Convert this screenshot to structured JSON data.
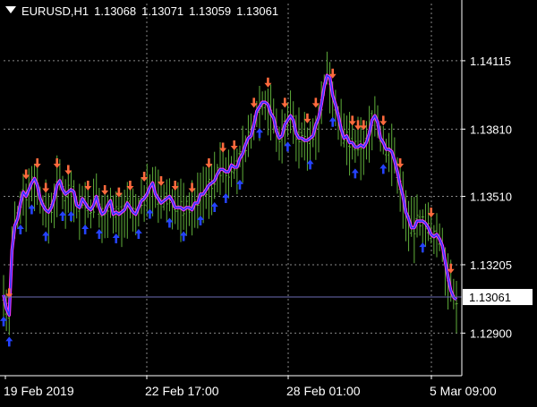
{
  "header": {
    "symbol": "EURUSD,H1",
    "open": "1.13068",
    "high": "1.13071",
    "low": "1.13059",
    "close": "1.13061"
  },
  "current_price_label": "1.13061",
  "colors": {
    "background": "#000000",
    "axis": "#ffffff",
    "grid": "#888888",
    "bars": "#5fae3a",
    "ma_outer": "#ff33ff",
    "ma_inner": "#1f3cff",
    "arrow_up": "#2442ff",
    "arrow_down": "#ff6a3d",
    "price_line": "#6b6bb5"
  },
  "chart_data": {
    "type": "ohlc",
    "title": "EURUSD,H1",
    "y_ticks": [
      "1.14115",
      "1.13810",
      "1.13510",
      "1.13205",
      "1.12900"
    ],
    "x_ticks": [
      "19 Feb 2019",
      "22 Feb 17:00",
      "28 Feb 01:00",
      "5 Mar 09:00"
    ],
    "ylim": [
      1.1271,
      1.1437
    ],
    "current_price": 1.13061,
    "grid": true,
    "series": [
      {
        "kind": "moving_average",
        "values": [
          1.1307,
          1.1301,
          1.1298,
          1.1327,
          1.1338,
          1.1341,
          1.1348,
          1.1353,
          1.1351,
          1.1354,
          1.1357,
          1.1359,
          1.1356,
          1.135,
          1.1347,
          1.1345,
          1.1344,
          1.1346,
          1.135,
          1.1356,
          1.1358,
          1.1354,
          1.1352,
          1.1353,
          1.1354,
          1.1353,
          1.1347,
          1.1346,
          1.135,
          1.1348,
          1.1346,
          1.1345,
          1.1347,
          1.1351,
          1.1346,
          1.1343,
          1.1344,
          1.1347,
          1.1349,
          1.1343,
          1.1344,
          1.1343,
          1.1344,
          1.1345,
          1.1348,
          1.1346,
          1.1344,
          1.1343,
          1.1346,
          1.1349,
          1.135,
          1.1352,
          1.1355,
          1.1357,
          1.1352,
          1.135,
          1.1348,
          1.1349,
          1.135,
          1.1351,
          1.1349,
          1.1346,
          1.1346,
          1.1346,
          1.1345,
          1.1346,
          1.1346,
          1.1345,
          1.1348,
          1.1348,
          1.1352,
          1.1352,
          1.1354,
          1.1356,
          1.1357,
          1.1358,
          1.1361,
          1.1363,
          1.1363,
          1.1362,
          1.1362,
          1.1365,
          1.1364,
          1.1364,
          1.1368,
          1.137,
          1.1374,
          1.1377,
          1.1378,
          1.1383,
          1.1389,
          1.1391,
          1.1393,
          1.1393,
          1.1392,
          1.1388,
          1.1386,
          1.138,
          1.1377,
          1.1378,
          1.1383,
          1.1385,
          1.1387,
          1.1385,
          1.1379,
          1.1377,
          1.1377,
          1.1376,
          1.1376,
          1.1377,
          1.1378,
          1.1383,
          1.1386,
          1.1392,
          1.14,
          1.1405,
          1.1404,
          1.1396,
          1.1392,
          1.1387,
          1.1381,
          1.1377,
          1.1378,
          1.1375,
          1.1375,
          1.1373,
          1.1373,
          1.1374,
          1.1373,
          1.1375,
          1.1379,
          1.1385,
          1.1387,
          1.1384,
          1.1377,
          1.1375,
          1.1372,
          1.1372,
          1.1371,
          1.1367,
          1.1362,
          1.1356,
          1.1351,
          1.1344,
          1.1341,
          1.1337,
          1.1337,
          1.134,
          1.134,
          1.134,
          1.1339,
          1.1337,
          1.1334,
          1.1333,
          1.1334,
          1.1332,
          1.1329,
          1.1322,
          1.1315,
          1.1309,
          1.1306,
          1.1305
        ]
      }
    ],
    "arrows": {
      "up_bars": [
        0,
        2,
        6,
        10,
        15,
        21,
        24,
        29,
        34,
        40,
        48,
        52,
        59,
        64,
        70,
        75,
        79,
        84,
        91,
        101,
        109,
        117,
        125,
        135,
        149
      ],
      "down_bars": [
        2,
        8,
        12,
        15,
        19,
        23,
        30,
        36,
        41,
        45,
        50,
        56,
        61,
        67,
        73,
        78,
        82,
        89,
        94,
        100,
        108,
        111,
        117,
        124,
        126,
        128,
        135,
        141,
        152,
        159,
        162
      ]
    }
  }
}
